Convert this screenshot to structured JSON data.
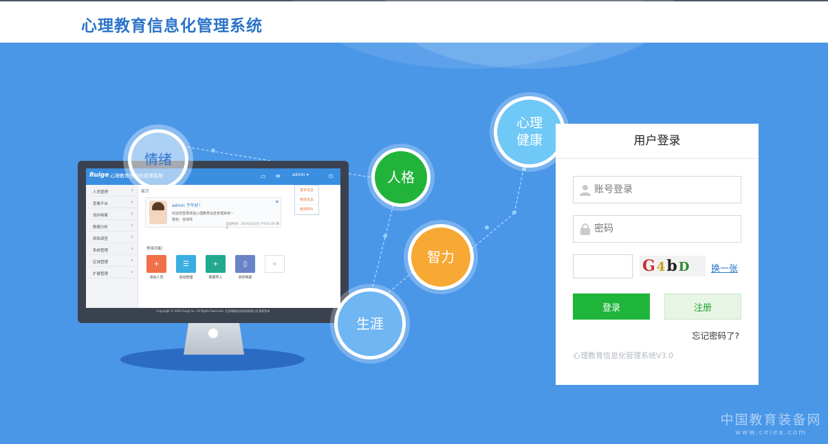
{
  "header": {
    "title": "心理教育信息化管理系统"
  },
  "bubbles": {
    "qingxu": "情绪",
    "renge": "人格",
    "zhili": "智力",
    "shengya": "生涯",
    "xinli_line1": "心理",
    "xinli_line2": "健康"
  },
  "mini_screen": {
    "logo": "Ruige",
    "system_name": "心理教育信息化管理系统",
    "user": "admin ▾",
    "dropdown": [
      "基本信息",
      "修改信息",
      "修改照片"
    ],
    "sidebar": [
      "人员管理",
      "查看平台",
      "测评档案",
      "数据分析",
      "网络调查",
      "系统管理",
      "区域管理",
      "扩展管理"
    ],
    "crumb": "首页",
    "welcome_line1": "admin  下午好！",
    "welcome_line2": "欢迎您登录体验心理教育信息管理系统~",
    "welcome_line3": "角色：咨询师",
    "welcome_time": "当前时间：2016/10/29  下午01:00  周三",
    "quick_title": "常用功能：",
    "tiles": [
      {
        "label": "添加人员",
        "color": "#f0704a"
      },
      {
        "label": "咨询管理",
        "color": "#3aaee0"
      },
      {
        "label": "数据导入",
        "color": "#22a88f"
      },
      {
        "label": "测评档案",
        "color": "#6a83c6"
      },
      {
        "label": "",
        "color": "#ffffff"
      }
    ],
    "footer": "Copyright © 2016 Ruige Inc. All Rights Reserved. 北京瑞格倍优科技有限公司 版权所有"
  },
  "login": {
    "title": "用户登录",
    "username_placeholder": "账号登录",
    "password_placeholder": "密码",
    "captcha_value": "",
    "captcha_chars": [
      "G",
      "4",
      "b",
      "D"
    ],
    "refresh_label": "换一张",
    "login_button": "登录",
    "register_button": "注册",
    "forgot_label": "忘记密码了?",
    "version": "心理教育信息化管理系统V3.0"
  },
  "watermark": {
    "line1": "中国教育装备网",
    "line2": "www.ceiea.com"
  },
  "colors": {
    "background": "#4a97e8",
    "title_blue": "#2b73c9",
    "login_green": "#1fb53a",
    "register_bg": "#e6f5e4"
  }
}
